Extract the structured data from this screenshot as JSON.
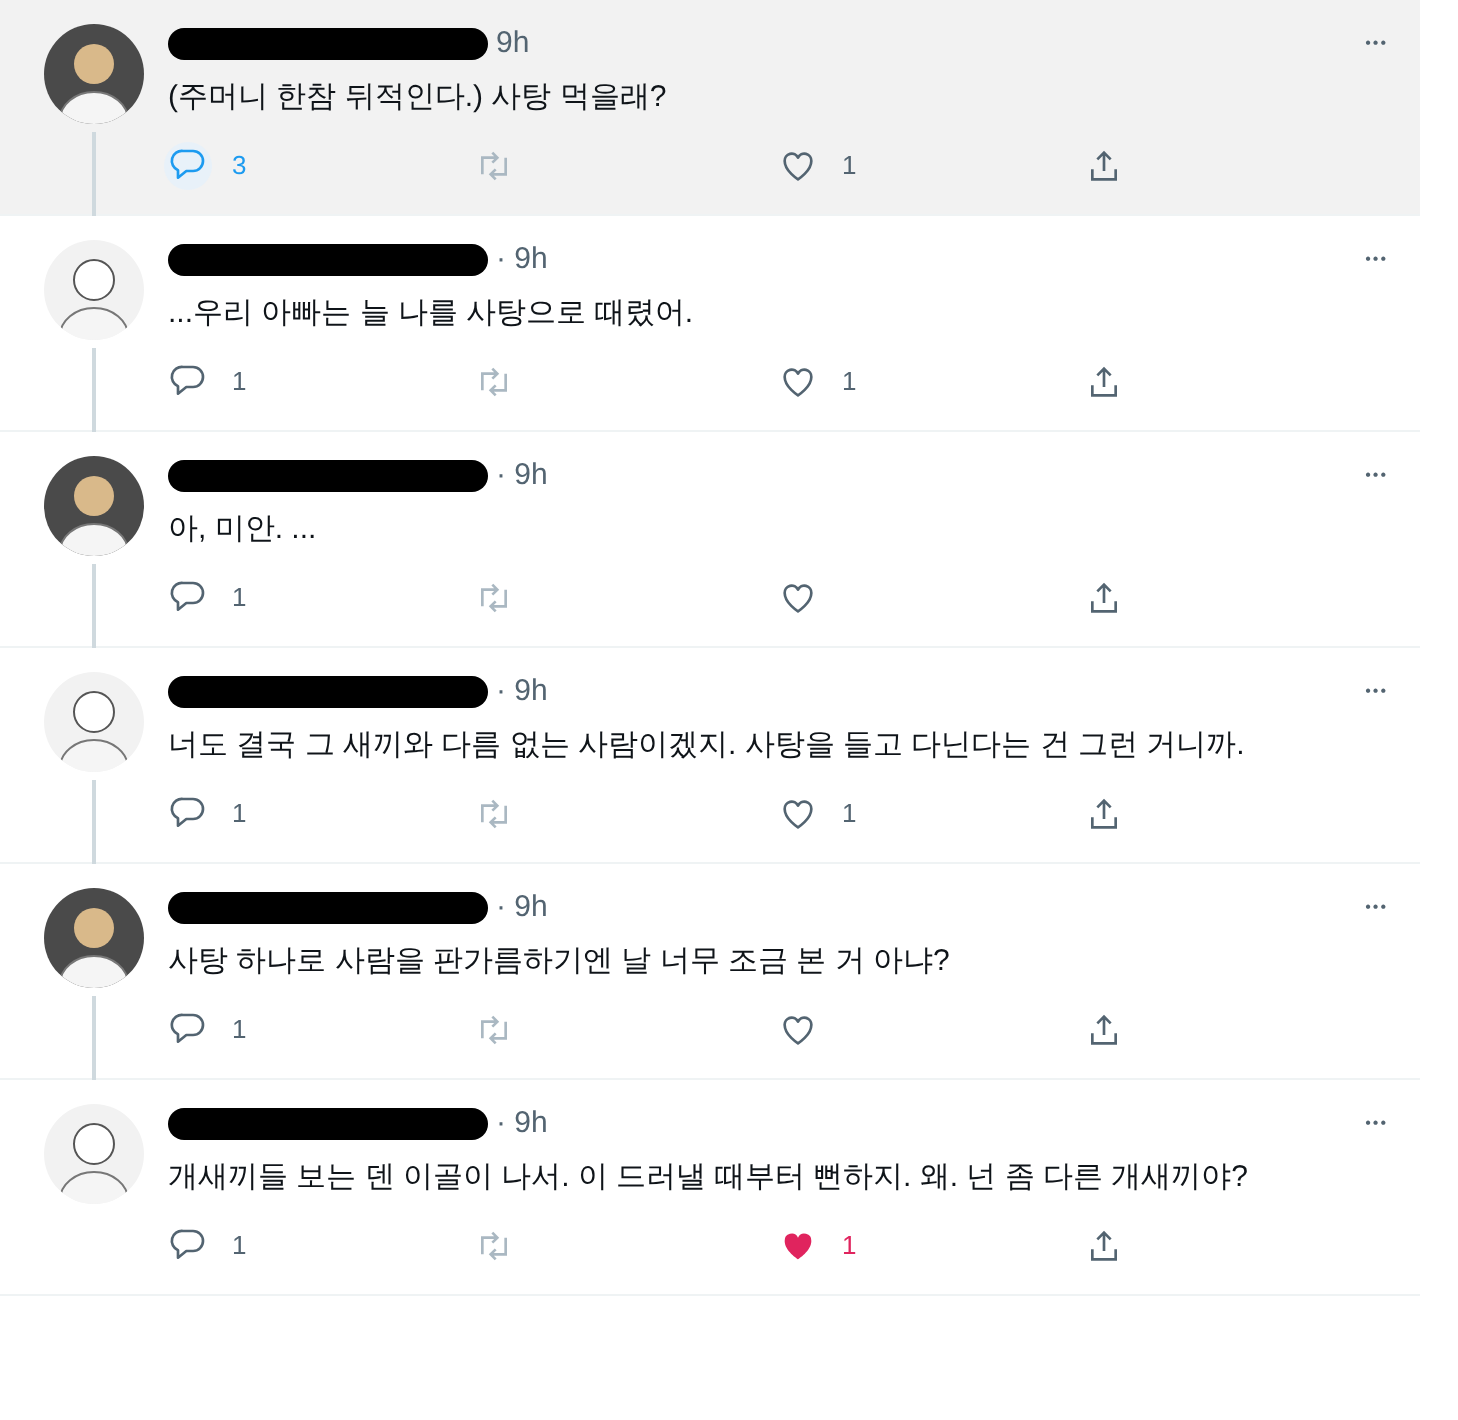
{
  "tweets": [
    {
      "time": "9h",
      "menu": "•••",
      "text": "(주머니 한참 뒤적인다.) 사탕 먹을래?",
      "hovered": true,
      "reply": {
        "count": "3",
        "highlighted": true
      },
      "like": {
        "count": "1",
        "liked": false
      }
    },
    {
      "time": "· 9h",
      "menu": "•••",
      "text": "...우리 아빠는 늘 나를 사탕으로 때렸어.",
      "hovered": false,
      "reply": {
        "count": "1",
        "highlighted": false
      },
      "like": {
        "count": "1",
        "liked": false
      }
    },
    {
      "time": "· 9h",
      "menu": "•••",
      "text": "아, 미안. ...",
      "hovered": false,
      "reply": {
        "count": "1",
        "highlighted": false
      },
      "like": {
        "liked": false
      }
    },
    {
      "time": "· 9h",
      "menu": "•••",
      "text": "너도 결국 그 새끼와 다름 없는 사람이겠지. 사탕을 들고 다닌다는 건 그런 거니까.",
      "hovered": false,
      "reply": {
        "count": "1",
        "highlighted": false
      },
      "like": {
        "count": "1",
        "liked": false
      }
    },
    {
      "time": "· 9h",
      "menu": "•••",
      "text": "사탕 하나로 사람을 판가름하기엔 날 너무 조금 본 거 아냐?",
      "hovered": false,
      "reply": {
        "count": "1",
        "highlighted": false
      },
      "like": {
        "liked": false
      }
    },
    {
      "time": "· 9h",
      "menu": "•••",
      "text": "개새끼들 보는 덴 이골이 나서. 이 드러낼 때부터 뻔하지. 왜. 넌 좀 다른 개새끼야?",
      "hovered": false,
      "reply": {
        "count": "1",
        "highlighted": false
      },
      "like": {
        "count": "1",
        "liked": true
      }
    }
  ]
}
